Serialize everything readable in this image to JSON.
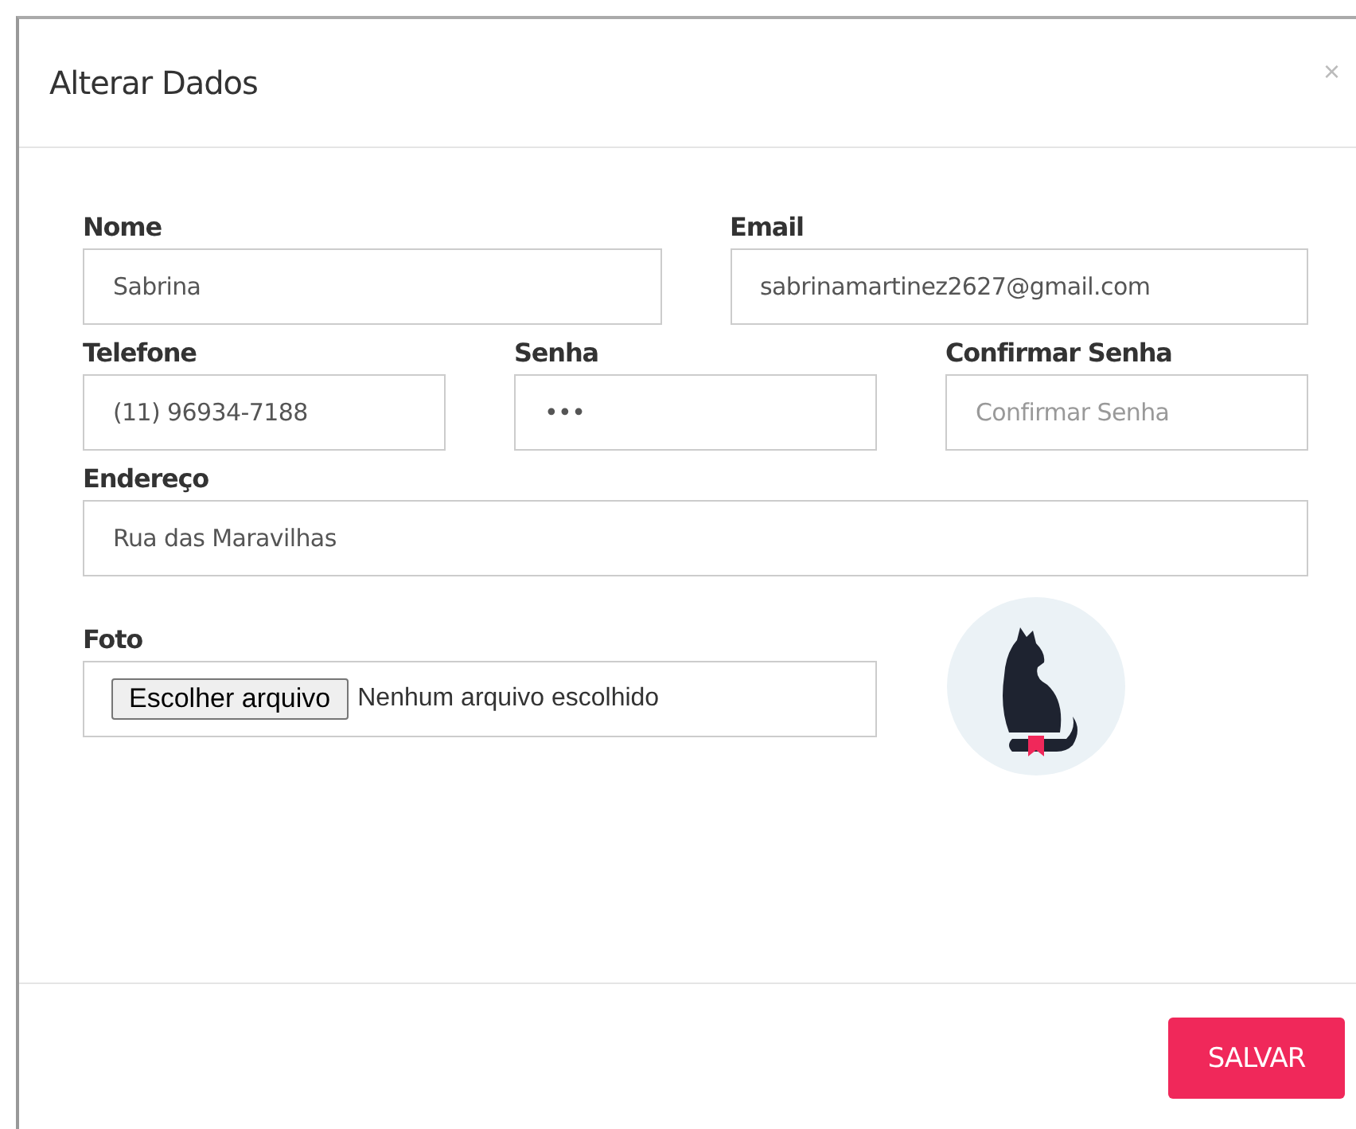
{
  "dialog": {
    "title": "Alterar Dados",
    "close": "×"
  },
  "rows": [
    {
      "fields": [
        {
          "label": "Nome",
          "value": "Sabrina"
        },
        {
          "label": "Email",
          "value": "sabrinamartinez2627@gmail.com"
        }
      ]
    },
    {
      "fields": [
        {
          "label": "Telefone",
          "value": "(11) 96934-7188"
        },
        {
          "label": "Senha",
          "value": "•••"
        },
        {
          "label": "Confirmar Senha",
          "placeholder": "Confirmar Senha"
        }
      ]
    },
    {
      "fields": [
        {
          "label": "Endereço",
          "value": "Rua das Maravilhas"
        }
      ]
    }
  ],
  "photo": {
    "label": "Foto",
    "button": "Escolher arquivo",
    "status": "Nenhum arquivo escolhido"
  },
  "save_button": "SALVAR"
}
